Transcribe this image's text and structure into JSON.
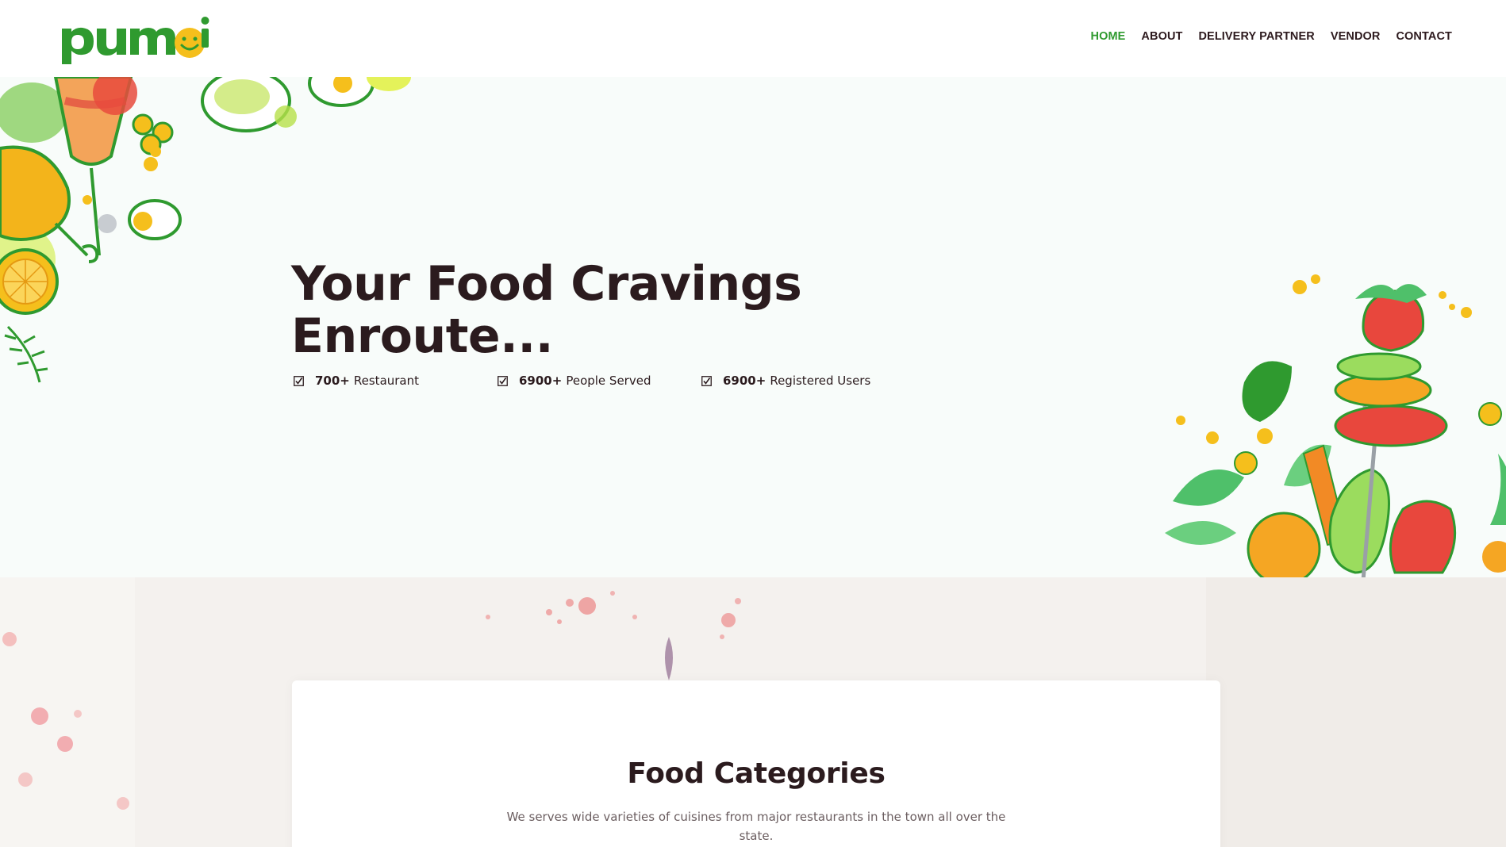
{
  "brand": {
    "logo_text": "pumpi",
    "green": "#2f9a2f",
    "yellow": "#f5bf1c",
    "dark": "#2b1b1e"
  },
  "nav": {
    "items": [
      {
        "label": "HOME",
        "active": true
      },
      {
        "label": "ABOUT",
        "active": false
      },
      {
        "label": "DELIVERY PARTNER",
        "active": false
      },
      {
        "label": "VENDOR",
        "active": false
      },
      {
        "label": "CONTACT",
        "active": false
      }
    ]
  },
  "hero": {
    "title_line1": "Your Food Cravings",
    "title_line2": "Enroute...",
    "stats": [
      {
        "icon": "checkbox-icon",
        "value": "700+",
        "label": "Restaurant"
      },
      {
        "icon": "checkbox-icon",
        "value": "6900+",
        "label": "People Served"
      },
      {
        "icon": "checkbox-icon",
        "value": "6900+",
        "label": "Registered Users"
      }
    ]
  },
  "categories": {
    "title": "Food Categories",
    "description": "We serves wide varieties of cuisines from major restaurants in the town all over the state."
  }
}
